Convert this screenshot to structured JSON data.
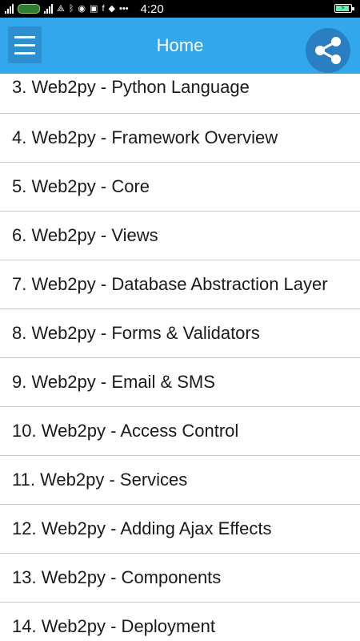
{
  "status_bar": {
    "time": "4:20",
    "icons": [
      "signal-icon",
      "carrier-logo-icon",
      "signal-icon",
      "network-icon",
      "bluetooth-icon",
      "messenger-icon",
      "instagram-icon",
      "facebook-icon",
      "shield-icon",
      "more-dots-icon",
      "battery-charging-icon"
    ]
  },
  "app_bar": {
    "title": "Home",
    "color": "#33a7ec",
    "menu_icon": "hamburger-menu-icon",
    "share_icon": "share-icon"
  },
  "list": {
    "items": [
      "3. Web2py - Python Language",
      "4. Web2py - Framework Overview",
      "5. Web2py - Core",
      "6. Web2py - Views",
      "7. Web2py - Database Abstraction Layer",
      "8. Web2py - Forms & Validators",
      "9. Web2py - Email & SMS",
      "10. Web2py - Access Control",
      "11. Web2py - Services",
      "12. Web2py - Adding Ajax Effects",
      "13. Web2py - Components",
      "14. Web2py - Deployment"
    ]
  }
}
